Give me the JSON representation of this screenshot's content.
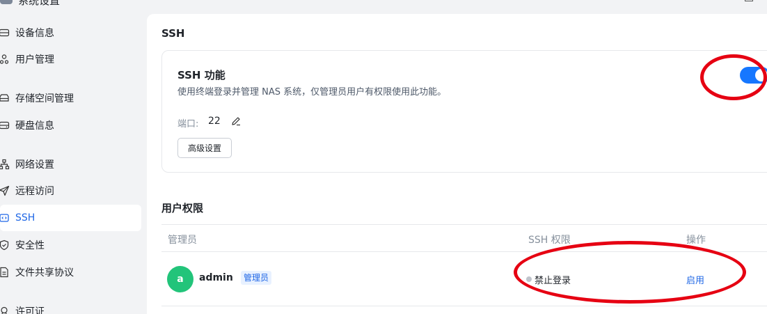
{
  "window": {
    "title": "系统设置",
    "icon": "settings-app-icon"
  },
  "sidebar": {
    "items": [
      {
        "label": "设备信息",
        "icon": "device-info-icon"
      },
      {
        "label": "用户管理",
        "icon": "users-icon"
      },
      {
        "label": "存储空间管理",
        "icon": "storage-icon"
      },
      {
        "label": "硬盘信息",
        "icon": "disk-icon"
      },
      {
        "label": "网络设置",
        "icon": "network-icon"
      },
      {
        "label": "远程访问",
        "icon": "send-icon"
      },
      {
        "label": "SSH",
        "icon": "ssh-icon",
        "active": true
      },
      {
        "label": "安全性",
        "icon": "shield-icon"
      },
      {
        "label": "文件共享协议",
        "icon": "file-icon"
      },
      {
        "label": "许可证",
        "icon": "license-icon"
      }
    ]
  },
  "main": {
    "section_title": "SSH",
    "ssh_card": {
      "title": "SSH 功能",
      "description": "使用终端登录并管理 NAS 系统，仅管理员用户有权限使用此功能。",
      "port_label": "端口:",
      "port_value": "22",
      "advanced_button": "高级设置",
      "enabled": true
    },
    "permissions_title": "用户权限",
    "table": {
      "headers": [
        "管理员",
        "SSH 权限",
        "操作"
      ],
      "rows": [
        {
          "avatar_letter": "a",
          "username": "admin",
          "role": "管理员",
          "ssh_permission": "禁止登录",
          "action": "启用"
        }
      ]
    }
  },
  "colors": {
    "accent": "#1677ff",
    "annotation": "#e60012",
    "avatar": "#22c47a"
  }
}
